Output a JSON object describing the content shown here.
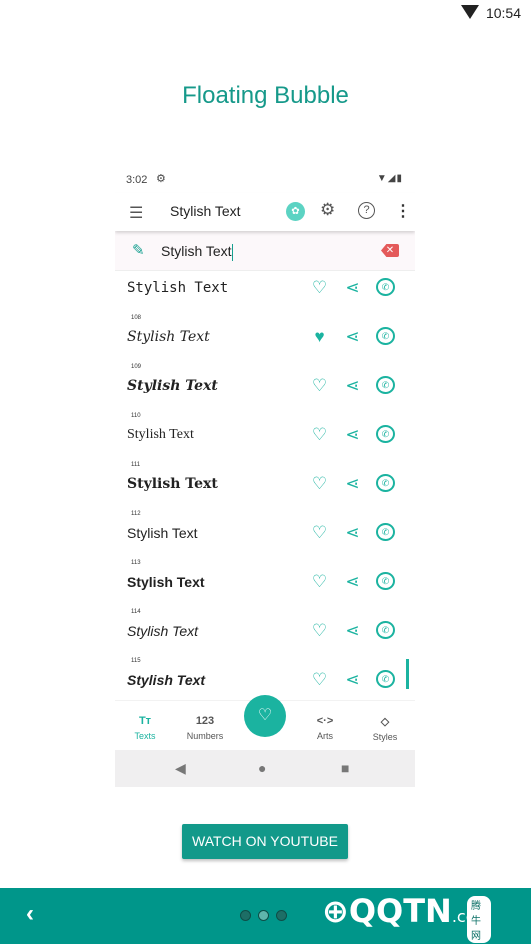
{
  "status_bar": {
    "time": "10:54"
  },
  "title": "Floating Bubble",
  "phone": {
    "status": {
      "time": "3:02"
    },
    "toolbar": {
      "title": "Stylish Text"
    },
    "input": {
      "value": "Stylish Text"
    },
    "rows": [
      {
        "num": "",
        "text": "Stylish Text",
        "favorite": false
      },
      {
        "num": "108",
        "text": "Stylish Text",
        "favorite": true
      },
      {
        "num": "109",
        "text": "Stylish Text",
        "favorite": false
      },
      {
        "num": "110",
        "text": "Stylish Text",
        "favorite": false
      },
      {
        "num": "111",
        "text": "Stylish Text",
        "favorite": false
      },
      {
        "num": "112",
        "text": "Stylish Text",
        "favorite": false
      },
      {
        "num": "113",
        "text": "Stylish Text",
        "favorite": false
      },
      {
        "num": "114",
        "text": "Stylish Text",
        "favorite": false
      },
      {
        "num": "115",
        "text": "Stylish Text",
        "favorite": false
      }
    ],
    "bottom_nav": [
      {
        "glyph": "Tт",
        "label": "Texts",
        "active": true
      },
      {
        "glyph": "123",
        "label": "Numbers",
        "active": false
      },
      {
        "glyph": "<·>",
        "label": "Arts",
        "active": false
      },
      {
        "glyph": "◇",
        "label": "Styles",
        "active": false
      }
    ]
  },
  "watch_button": "WATCH ON YOUTUBE",
  "pager": {
    "pages": 3,
    "current": 2
  },
  "watermark": "QQTN.com 腾牛网",
  "colors": {
    "accent": "#1bb3a0",
    "title": "#16998a",
    "bottom_bar": "#00968a",
    "delete": "#e45a5a"
  }
}
